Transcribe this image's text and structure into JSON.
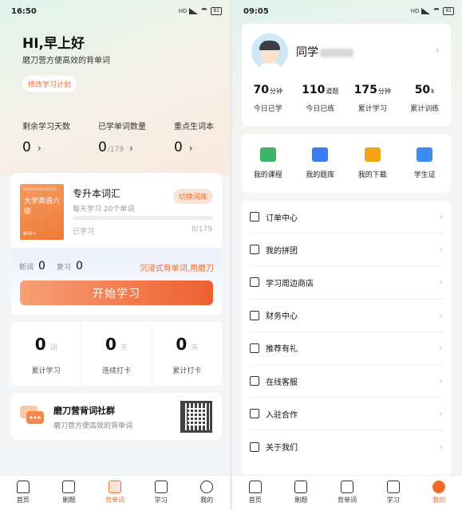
{
  "left": {
    "status": {
      "time": "16:50",
      "battery": "81"
    },
    "greeting": "HI,早上好",
    "subtitle": "磨刀营方便高效的背单词",
    "plan_button": "修改学习计划",
    "stats": [
      {
        "label": "剩余学习天数",
        "value": "0",
        "total": ""
      },
      {
        "label": "已学单词数量",
        "value": "0",
        "total": "/179"
      },
      {
        "label": "重点生词本",
        "value": "0",
        "total": ""
      }
    ],
    "book": {
      "cover_top": "MODAOYING WORDS",
      "cover_title": "大学英语六级",
      "cover_count": "800+",
      "name": "专升本词汇",
      "daily_plan": "每天学习 20个单词",
      "switch_label": "切换词库",
      "learned_label": "已学习",
      "learned_count": "0/179",
      "progress": 0
    },
    "today": {
      "new_label": "新词",
      "new_value": "0",
      "review_label": "复习",
      "review_value": "0"
    },
    "slogan": "沉浸式背单词,用磨刀",
    "start_button": "开始学习",
    "totals": [
      {
        "value": "0",
        "unit": "词",
        "label": "累计学习"
      },
      {
        "value": "0",
        "unit": "天",
        "label": "连续打卡"
      },
      {
        "value": "0",
        "unit": "天",
        "label": "累计打卡"
      }
    ],
    "community": {
      "title": "磨刀营背词社群",
      "subtitle": "磨刀营方便高效的背单词"
    },
    "tabs": [
      "首页",
      "刷题",
      "背单词",
      "学习",
      "我的"
    ],
    "active_tab": 2
  },
  "right": {
    "status": {
      "time": "09:05",
      "battery": "81"
    },
    "username": "同学",
    "stats": [
      {
        "value": "70",
        "unit": "分钟",
        "label": "今日已学"
      },
      {
        "value": "110",
        "unit": "道题",
        "label": "今日已练"
      },
      {
        "value": "175",
        "unit": "分钟",
        "label": "累计学习"
      },
      {
        "value": "50",
        "unit": "k",
        "label": "累计训练"
      }
    ],
    "quick": [
      {
        "label": "我的课程",
        "icon": "book-icon",
        "color": "#3bb36a"
      },
      {
        "label": "我的题库",
        "icon": "question-bank-icon",
        "color": "#3c7bf0"
      },
      {
        "label": "我的下载",
        "icon": "download-icon",
        "color": "#f2a516"
      },
      {
        "label": "学生证",
        "icon": "student-card-icon",
        "color": "#3c8cf0"
      }
    ],
    "menu": [
      {
        "label": "订单中心",
        "icon": "order-icon"
      },
      {
        "label": "我的拼团",
        "icon": "group-buy-icon"
      },
      {
        "label": "学习周边商店",
        "icon": "shop-icon"
      },
      {
        "label": "财务中心",
        "icon": "wallet-icon"
      },
      {
        "label": "推荐有礼",
        "icon": "thumb-up-icon"
      },
      {
        "label": "在线客服",
        "icon": "headset-icon"
      },
      {
        "label": "入驻合作",
        "icon": "handshake-icon"
      },
      {
        "label": "关于我们",
        "icon": "info-icon"
      }
    ],
    "tabs": [
      "首页",
      "刷题",
      "背单词",
      "学习",
      "我的"
    ],
    "active_tab": 4
  },
  "accent_color": "#f26b2a"
}
